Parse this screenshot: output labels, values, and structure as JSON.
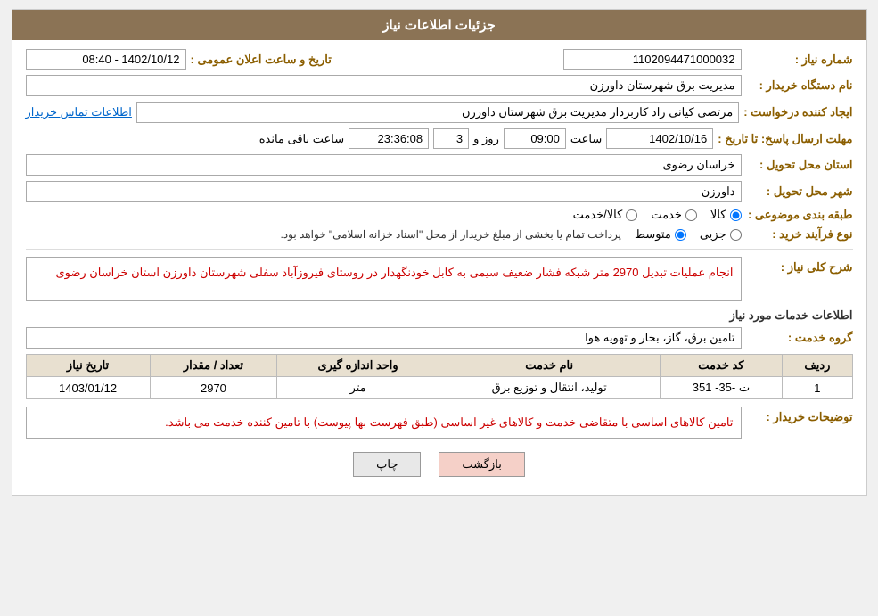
{
  "header": {
    "title": "جزئیات اطلاعات نیاز"
  },
  "fields": {
    "shomareNiaz_label": "شماره نیاز :",
    "shomareNiaz_value": "1102094471000032",
    "namDastgah_label": "نام دستگاه خریدار :",
    "namDastgah_value": "مدیریت برق شهرستان داورزن",
    "tarikhElan_label": "تاریخ و ساعت اعلان عمومی :",
    "tarikhElan_value": "1402/10/12 - 08:40",
    "ijadKonande_label": "ایجاد کننده درخواست :",
    "ijadKonande_value": "مرتضی کیانی راد کاربردار مدیریت برق شهرستان داورزن",
    "etelaatTamas_label": "اطلاعات تماس خریدار",
    "mohlat_label": "مهلت ارسال پاسخ: تا تاریخ :",
    "date_value": "1402/10/16",
    "saatLabel": "ساعت",
    "saat_value": "09:00",
    "roozLabel": "روز و",
    "rooz_value": "3",
    "baghimande_value": "23:36:08",
    "saatBaghimande_label": "ساعت باقی مانده",
    "ostan_label": "استان محل تحویل :",
    "ostan_value": "خراسان رضوی",
    "shahr_label": "شهر محل تحویل :",
    "shahr_value": "داورزن",
    "tabaqe_label": "طبقه بندی موضوعی :",
    "tabaqe_kala": "کالا",
    "tabaqe_khadamat": "خدمت",
    "tabaqe_kala_khadamat": "کالا/خدمت",
    "noeFarayand_label": "نوع فرآیند خرید :",
    "noeFarayand_jazee": "جزیی",
    "noeFarayand_motevaset": "متوسط",
    "noeFarayand_notice": "پرداخت تمام یا بخشی از مبلغ خریدار از محل \"اسناد خزانه اسلامی\" خواهد بود.",
    "sharh_label": "شرح کلی نیاز :",
    "sharh_value": "انجام عملیات تبدیل 2970 متر شبکه فشار ضعیف سیمی به کابل خودنگهدار در روستای فیروزآباد سفلی شهرستان داورزن استان خراسان رضوی",
    "khadamat_section_label": "اطلاعات خدمات مورد نیاز",
    "goroh_label": "گروه خدمت :",
    "goroh_value": "تامین برق، گاز، بخار و تهویه هوا",
    "table_headers": {
      "radif": "ردیف",
      "kodKhadamat": "کد خدمت",
      "namKhadamat": "نام خدمت",
      "vahadAndaze": "واحد اندازه گیری",
      "tedadMeghdar": "تعداد / مقدار",
      "tarikhNiaz": "تاریخ نیاز"
    },
    "table_rows": [
      {
        "radif": "1",
        "kodKhadamat": "ت -35- 351",
        "namKhadamat": "تولید، انتقال و توزیع برق",
        "vahadAndaze": "متر",
        "tedadMeghdar": "2970",
        "tarikhNiaz": "1403/01/12"
      }
    ],
    "tazih_label": "توضیحات خریدار :",
    "tazih_value": "تامین کالاهای اساسی با متقاضی خدمت و کالاهای غیر اساسی (طبق فهرست بها پیوست) با تامین کننده خدمت می باشد."
  },
  "buttons": {
    "chap": "چاپ",
    "bazgasht": "بازگشت"
  }
}
